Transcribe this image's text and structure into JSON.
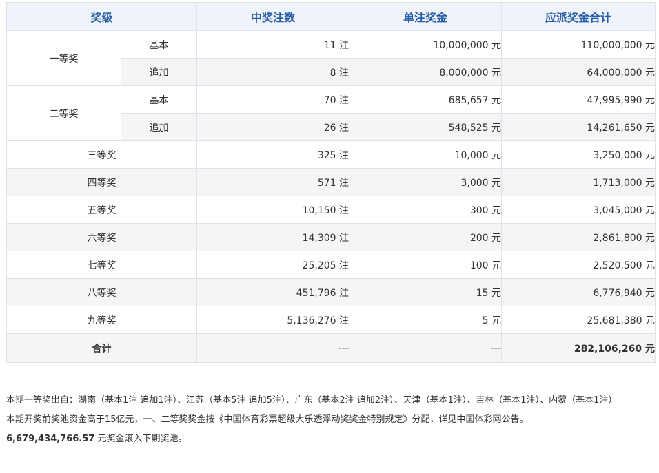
{
  "header": {
    "level": "奖级",
    "winners": "中奖注数",
    "per_bet": "单注奖金",
    "total": "应派奖金合计"
  },
  "rows": [
    {
      "level": "一等奖",
      "sub": "基本",
      "winners": "11 注",
      "per_bet": "10,000,000 元",
      "total": "110,000,000 元"
    },
    {
      "level": "一等奖",
      "sub": "追加",
      "winners": "8 注",
      "per_bet": "8,000,000 元",
      "total": "64,000,000 元"
    },
    {
      "level": "二等奖",
      "sub": "基本",
      "winners": "70 注",
      "per_bet": "685,657 元",
      "total": "47,995,990 元"
    },
    {
      "level": "二等奖",
      "sub": "追加",
      "winners": "26 注",
      "per_bet": "548,525 元",
      "total": "14,261,650 元"
    },
    {
      "level": "三等奖",
      "winners": "325 注",
      "per_bet": "10,000 元",
      "total": "3,250,000 元"
    },
    {
      "level": "四等奖",
      "winners": "571 注",
      "per_bet": "3,000 元",
      "total": "1,713,000 元"
    },
    {
      "level": "五等奖",
      "winners": "10,150 注",
      "per_bet": "300 元",
      "total": "3,045,000 元"
    },
    {
      "level": "六等奖",
      "winners": "14,309 注",
      "per_bet": "200 元",
      "total": "2,861,800 元"
    },
    {
      "level": "七等奖",
      "winners": "25,205 注",
      "per_bet": "100 元",
      "total": "2,520,500 元"
    },
    {
      "level": "八等奖",
      "winners": "451,796 注",
      "per_bet": "15 元",
      "total": "6,776,940 元"
    },
    {
      "level": "九等奖",
      "winners": "5,136,276 注",
      "per_bet": "5 元",
      "total": "25,681,380 元"
    }
  ],
  "total_row": {
    "label": "合计",
    "winners": "---",
    "per_bet": "---",
    "total": "282,106,260 元"
  },
  "notes": {
    "line1": "本期一等奖出自：湖南（基本1注 追加1注）、江苏（基本5注 追加5注）、广东（基本2注 追加2注）、天津（基本1注）、吉林（基本1注）、内蒙（基本1注）",
    "line2": "本期开奖前奖池资金高于15亿元，一、二等奖奖金按《中国体育彩票超级大乐透浮动奖奖金特别规定》分配，详见中国体彩网公告。",
    "pool_amount": "6,679,434,766.57",
    "pool_suffix": " 元奖金滚入下期奖池。"
  }
}
